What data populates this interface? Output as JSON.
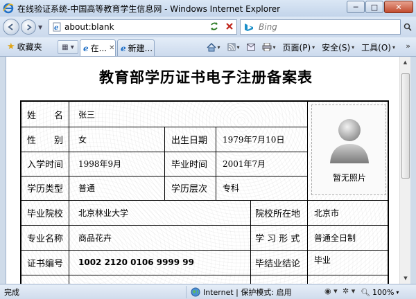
{
  "window": {
    "title": "在线验证系统-中国高等教育学生信息网 - Windows Internet Explorer",
    "minimize": "─",
    "maximize": "□",
    "close": "✕"
  },
  "address_bar": {
    "url": "about:blank",
    "search_placeholder": "Bing"
  },
  "toolbar": {
    "favorites_label": "收藏夹",
    "tabs": [
      {
        "label": "在...",
        "close": "✕"
      },
      {
        "label": "新建..."
      }
    ],
    "page_label": "页面(P)",
    "safety_label": "安全(S)",
    "tools_label": "工具(O)",
    "more": "»"
  },
  "document": {
    "title": "教育部学历证书电子注册备案表",
    "labels": {
      "name": "姓　　名",
      "gender": "性　　别",
      "birth_date": "出生日期",
      "enroll_date": "入学时间",
      "grad_date": "毕业时间",
      "edu_type": "学历类型",
      "edu_level": "学历层次",
      "school": "毕业院校",
      "school_location": "院校所在地",
      "major": "专业名称",
      "study_form": "学 习 形 式",
      "cert_no": "证书编号",
      "conclusion": "毕结业结论"
    },
    "values": {
      "name": "张三",
      "gender": "女",
      "birth_date": "1979年7月10日",
      "enroll_date": "1998年9月",
      "grad_date": "2001年7月",
      "edu_type": "普通",
      "edu_level": "专科",
      "school": "北京林业大学",
      "school_location": "北京市",
      "major": "商品花卉",
      "study_form": "普通全日制",
      "cert_no": "1002 2120 0106 9999 99",
      "conclusion": "毕业"
    },
    "photo_caption": "暂无照片"
  },
  "status_bar": {
    "status": "完成",
    "zone": "Internet | 保护模式: 启用",
    "zoom": "100%"
  },
  "icons": {
    "back": "back-arrow-icon",
    "forward": "forward-arrow-icon",
    "refresh": "refresh-icon",
    "stop": "stop-icon",
    "search": "search-icon",
    "favorites": "star-icon",
    "home": "home-icon",
    "feeds": "rss-icon",
    "print": "printer-icon",
    "globe": "globe-icon"
  },
  "colors": {
    "chrome": "#cfdbe9",
    "ie_blue": "#1f6fc6",
    "close_red": "#c14b2e"
  }
}
